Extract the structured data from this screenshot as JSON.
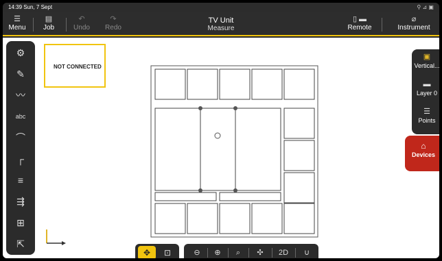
{
  "status_bar": {
    "time_date": "14:39  Sun, 7 Sept",
    "system_icons": "⚲ ⊿ ▣"
  },
  "toolbar": {
    "menu_label": "Menu",
    "job_label": "Job",
    "undo_label": "Undo",
    "redo_label": "Redo",
    "title": "TV Unit",
    "subtitle": "Measure",
    "remote_label": "Remote",
    "instrument_label": "Instrument"
  },
  "canvas": {
    "connection_status": "NOT CONNECTED"
  },
  "left_tools": [
    {
      "icon": "settings-eye-icon"
    },
    {
      "icon": "wrench-icon"
    },
    {
      "icon": "polyline-icon"
    },
    {
      "icon": "text-tool-icon",
      "label": "abc"
    },
    {
      "icon": "arc-icon"
    },
    {
      "icon": "corner-icon"
    },
    {
      "icon": "align-icon"
    },
    {
      "icon": "offset-icon"
    },
    {
      "icon": "split-icon"
    },
    {
      "icon": "export-icon"
    }
  ],
  "right_panel": {
    "vertical_label": "Vertical...",
    "layer_label": "Layer 0",
    "points_label": "Points",
    "devices_label": "Devices"
  },
  "bottom_tools": {
    "mode_left": [
      "move-icon",
      "fit-icon"
    ],
    "view_tools": [
      "zoom-out-icon",
      "zoom-in-icon",
      "zoom-window-icon",
      "pan-icon",
      "2d-icon",
      "magnet-icon"
    ],
    "view_2d_label": "2D"
  },
  "colors": {
    "accent": "#f1c40f",
    "devices": "#c0271b",
    "toolbar": "#2d2d2d"
  }
}
